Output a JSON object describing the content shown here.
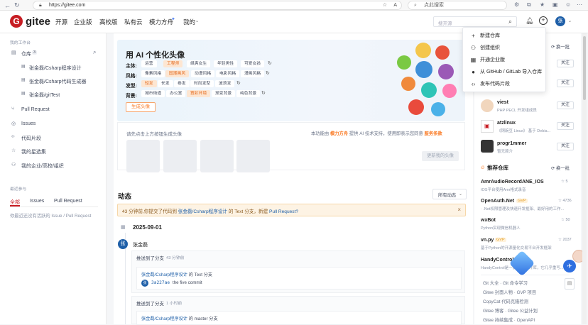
{
  "browser": {
    "url": "https://gitee.com",
    "search_placeholder": "点此搜索"
  },
  "header": {
    "logo_text": "gitee",
    "nav": [
      "开源",
      "企业版",
      "高校版",
      "私有云",
      "模力方舟",
      "我的"
    ],
    "search_placeholder": "搜开源",
    "avatar_letter": "张"
  },
  "sidebar": {
    "workbench_title": "我的工作台",
    "repos_label": "仓库",
    "repos_count": "3",
    "repos": [
      "张金磊/Csharp程序设计",
      "张金磊/Csharp代码生成器",
      "张金磊/gitTest"
    ],
    "links": [
      "Pull Request",
      "Issues",
      "代码片段",
      "我的星选集",
      "我的企业/高校/组织"
    ],
    "recent_title": "最近参与",
    "recent_tabs": [
      "全部",
      "Issues",
      "Pull Request"
    ],
    "recent_empty": "你最近还没有活跃的 Issue / Pull Request"
  },
  "ai": {
    "title": "用 AI 个性化头像",
    "rows": [
      {
        "label": "主体:",
        "items": [
          "运营",
          "工程师",
          "飒爽女生",
          "年轻男性",
          "可爱女孩"
        ],
        "active": 1
      },
      {
        "label": "风格:",
        "items": [
          "像素风格",
          "国潮画风",
          "动漫风格",
          "电影风格",
          "漫画风格"
        ],
        "active": 1
      },
      {
        "label": "发型:",
        "items": [
          "短发",
          "长发",
          "卷发",
          "时尚发型",
          "波浪发"
        ],
        "active": 0
      },
      {
        "label": "背景:",
        "items": [
          "城市街道",
          "办公室",
          "霓虹环境",
          "渐变背景",
          "纯色背景"
        ],
        "active": 2
      }
    ],
    "generate_btn": "生成头像",
    "hint": "请先点击上方按钮生成头像",
    "power_text_1": "本功能由",
    "power_brand": "模力方舟",
    "power_text_2": "提供 AI 技术支持，使用即表示您同意",
    "power_terms": "服务条款",
    "update_btn": "更新我的头像"
  },
  "feed": {
    "title": "动态",
    "filter": "所有动态",
    "notice_time": "43 分钟前,你提交了代码到",
    "notice_repo": "张金磊/Csharp程序设计",
    "notice_mid": "的 Text 分支，新建",
    "notice_link": "Pull Request?",
    "date": "2025-09-01",
    "user": "张金磊",
    "events": [
      {
        "action": "推送到了分支",
        "time": "43 分钟前",
        "repo": "张金磊/Csharp程序设计",
        "branch_text": "的 Text 分支",
        "commit": "3a227ae",
        "message": "the five commit"
      },
      {
        "action": "推送到了分支",
        "time": "1 小时前",
        "repo": "张金磊/Csharp程序设计",
        "branch_text": "的 master 分支"
      }
    ]
  },
  "menu": [
    "新建仓库",
    "创建组织",
    "开通企业版",
    "从 GitHub / GitLab 导入仓库",
    "发布代码片段"
  ],
  "right": {
    "swap": "换一批",
    "follow": "关注",
    "users": [
      {
        "name": "viest",
        "desc": "PHP PECL 开发组成员"
      },
      {
        "name": "atzlinux",
        "desc": "《铜豌豆 Linux》 基于 Debia..."
      },
      {
        "name": "progr1mmer",
        "desc": "暂无简介"
      }
    ],
    "recommend_title": "推荐仓库",
    "repos": [
      {
        "name": "AmrAudioRecordANE_IOS",
        "desc": "IOS平台使用Amr格式录音",
        "stars": "5"
      },
      {
        "name": "OpenAuth.Net",
        "badge": "GVP",
        "desc": "· .Net权限管理及快速开发框架、最好用的工作...",
        "stars": "4736"
      },
      {
        "name": "wxBot",
        "desc": "Python实现微信机器人",
        "stars": "50"
      },
      {
        "name": "vn.py",
        "badge": "GVP",
        "desc": "基于Python的开源量化交易平台开发框架",
        "stars": "2037"
      },
      {
        "name": "HandyControl",
        "desc": "HandyControl是一套WPF控件库，它几乎重写...",
        "stars": ""
      }
    ],
    "footer_links": [
      "Git 大全 · Git 命令学习",
      "Gitee 封面人物 · GVP 项目",
      "CopyCat 代码克隆检测",
      "Gitee 博客 · Gitee 公益计划",
      "Gitee 持续集成 · OpenAPI"
    ]
  },
  "colors": {
    "brand": "#c71d23",
    "accent_orange": "#fa7c27",
    "link_blue": "#1e5fa8",
    "notice_bg": "#fdf3e4"
  }
}
